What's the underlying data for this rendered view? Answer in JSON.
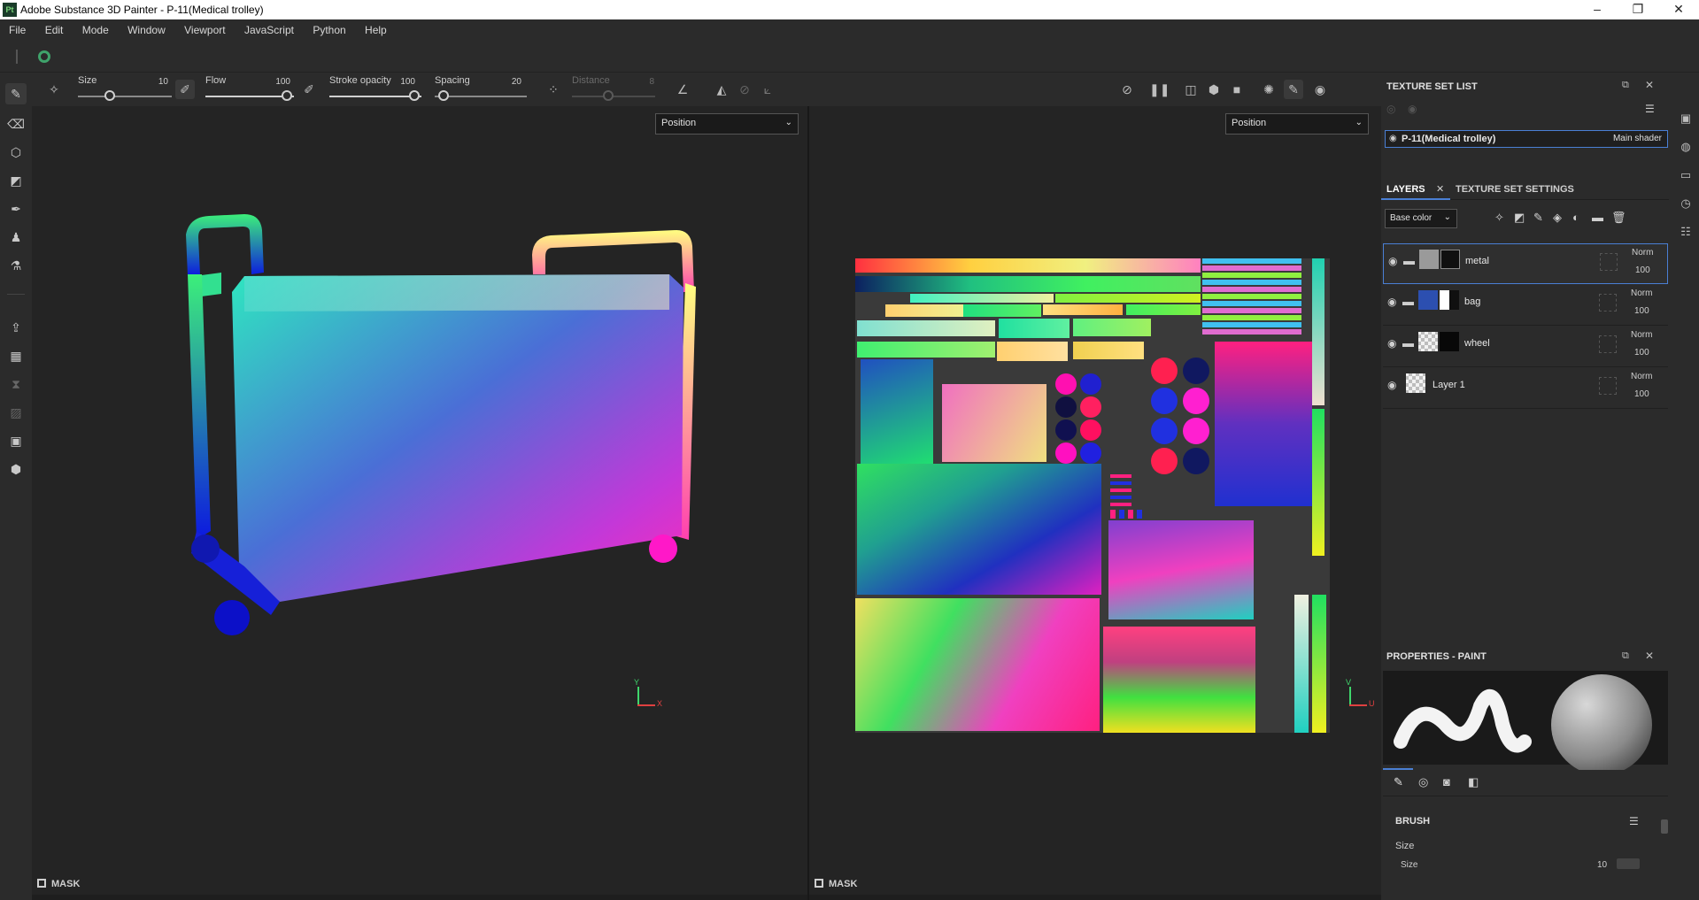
{
  "app": {
    "logo_text": "Pt",
    "title": "Adobe Substance 3D Painter - P-11(Medical trolley)",
    "window_buttons": [
      "–",
      "❐",
      "✕"
    ]
  },
  "menu": [
    "File",
    "Edit",
    "Mode",
    "Window",
    "Viewport",
    "JavaScript",
    "Python",
    "Help"
  ],
  "toolbar": {
    "size_label": "Size",
    "size_value": "10",
    "flow_label": "Flow",
    "flow_value": "100",
    "stroke_opacity_label": "Stroke opacity",
    "stroke_opacity_value": "100",
    "spacing_label": "Spacing",
    "spacing_value": "20",
    "distance_label": "Distance",
    "distance_value": "8"
  },
  "viewport_left": {
    "mode": "Position",
    "mask_label": "MASK",
    "axes": [
      "Y",
      "X"
    ]
  },
  "viewport_right": {
    "mode": "Position",
    "mask_label": "MASK",
    "axes": [
      "V",
      "U"
    ]
  },
  "texture_set_list": {
    "title": "TEXTURE SET LIST",
    "item_name": "P-11(Medical trolley)",
    "item_shader": "Main shader"
  },
  "layers_panel": {
    "tab_layers": "LAYERS",
    "tab_settings": "TEXTURE SET SETTINGS",
    "channel": "Base color",
    "layers": [
      {
        "name": "metal",
        "blend": "Norm",
        "opacity": "100"
      },
      {
        "name": "bag",
        "blend": "Norm",
        "opacity": "100"
      },
      {
        "name": "wheel",
        "blend": "Norm",
        "opacity": "100"
      },
      {
        "name": "Layer 1",
        "blend": "Norm",
        "opacity": "100"
      }
    ]
  },
  "properties": {
    "title": "PROPERTIES - PAINT",
    "section": "BRUSH",
    "size_label": "Size",
    "size_sub_label": "Size",
    "size_value": "10"
  },
  "colors": {
    "accent_blue": "#4a7fd4",
    "panel_bg": "#2b2b2b",
    "viewport_bg": "#242424"
  }
}
